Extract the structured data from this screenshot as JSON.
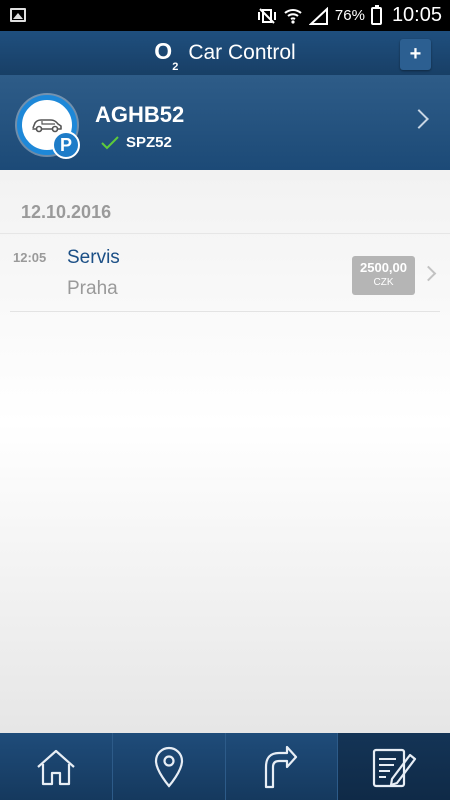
{
  "status_bar": {
    "battery": "76%",
    "time": "10:05"
  },
  "app_bar": {
    "brand": "O",
    "brand_sub": "2",
    "title": "Car Control",
    "add_label": "+"
  },
  "car": {
    "name": "AGHB52",
    "plate": "SPZ52",
    "badge": "P"
  },
  "list": {
    "date": "12.10.2016",
    "items": [
      {
        "time": "12:05",
        "title": "Servis",
        "subtitle": "Praha",
        "amount": "2500,00",
        "currency": "CZK"
      }
    ]
  },
  "bottom_nav": [
    {
      "icon": "home-icon"
    },
    {
      "icon": "location-pin-icon"
    },
    {
      "icon": "route-arrow-icon"
    },
    {
      "icon": "logbook-edit-icon",
      "active": true
    }
  ],
  "colors": {
    "primary": "#1c4a77",
    "accent_blue": "#1e88d8",
    "link_blue": "#1b4f86",
    "check_green": "#5ecb3a"
  }
}
